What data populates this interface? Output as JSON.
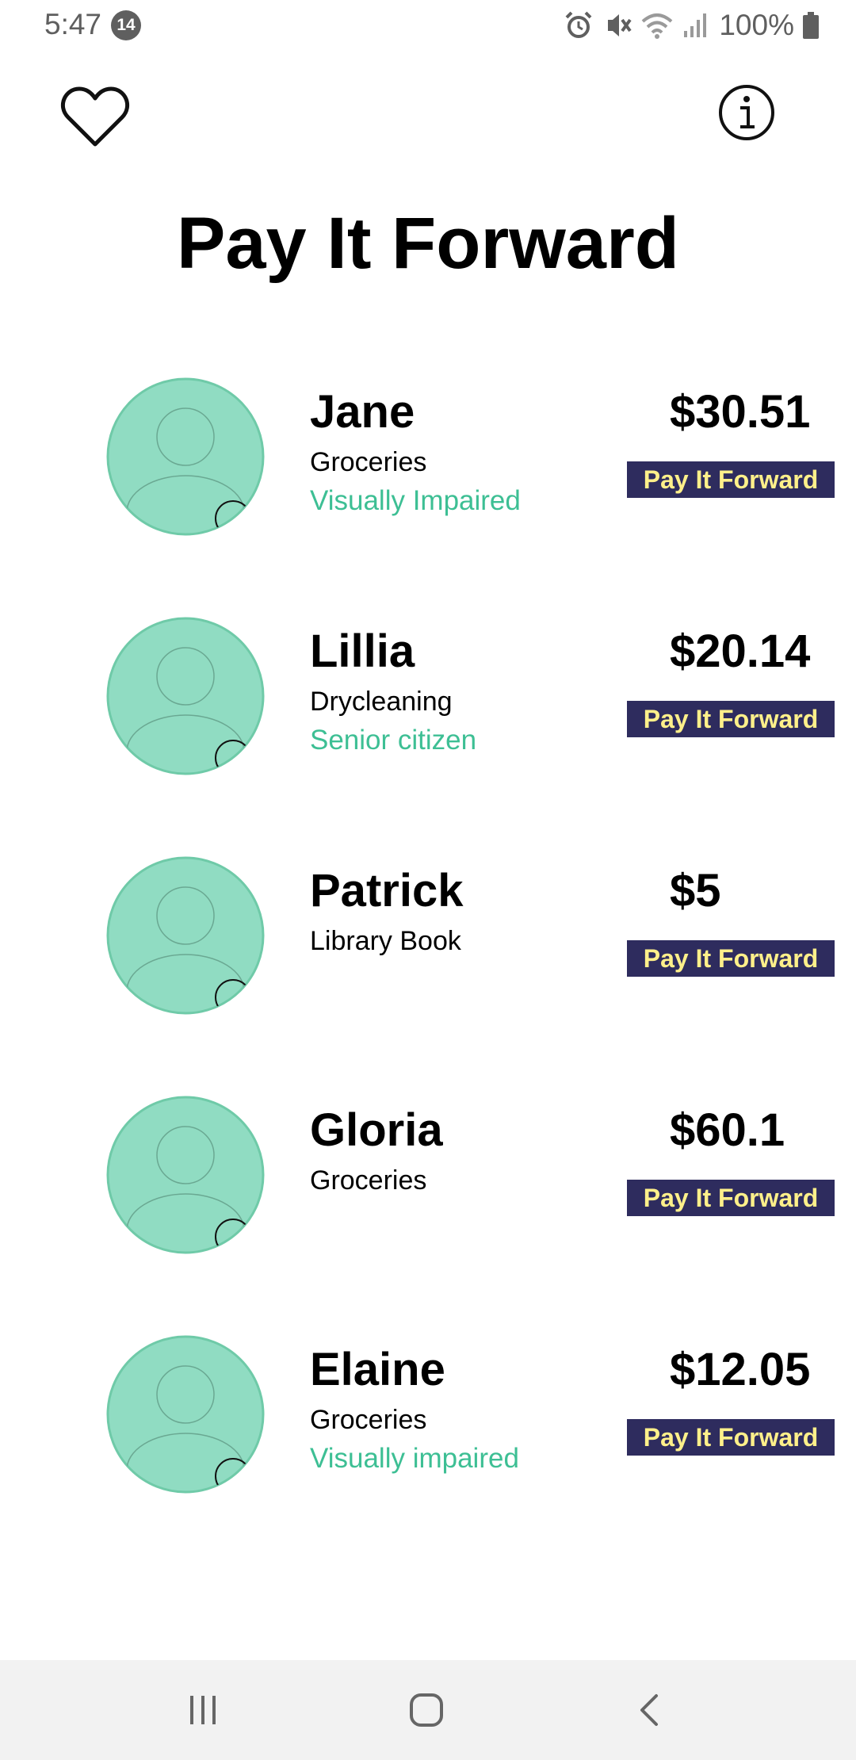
{
  "status_bar": {
    "time": "5:47",
    "notification_count": "14",
    "battery": "100%",
    "icons": [
      "alarm-icon",
      "vibrate-icon",
      "wifi-icon",
      "signal-icon",
      "battery-icon"
    ]
  },
  "toolbar": {
    "favorite_icon": "heart-icon",
    "info_icon": "info-icon"
  },
  "title": "Pay It Forward",
  "colors": {
    "avatar_fill": "#90dcc2",
    "accent_tag": "#3dbf94",
    "button_bg": "#2e2c5e",
    "button_text": "#fff08a"
  },
  "requests": [
    {
      "name": "Jane",
      "category": "Groceries",
      "tag": "Visually Impaired",
      "amount": "$30.51",
      "button": "Pay It Forward"
    },
    {
      "name": "Lillia",
      "category": "Drycleaning",
      "tag": "Senior citizen",
      "amount": "$20.14",
      "button": "Pay It Forward"
    },
    {
      "name": "Patrick",
      "category": "Library Book",
      "tag": "",
      "amount": "$5",
      "button": "Pay It Forward"
    },
    {
      "name": "Gloria",
      "category": "Groceries",
      "tag": "",
      "amount": "$60.1",
      "button": "Pay It Forward"
    },
    {
      "name": "Elaine",
      "category": "Groceries",
      "tag": "Visually impaired",
      "amount": "$12.05",
      "button": "Pay It Forward"
    }
  ],
  "nav": {
    "recents": "recents-icon",
    "home": "home-icon",
    "back": "back-icon"
  }
}
